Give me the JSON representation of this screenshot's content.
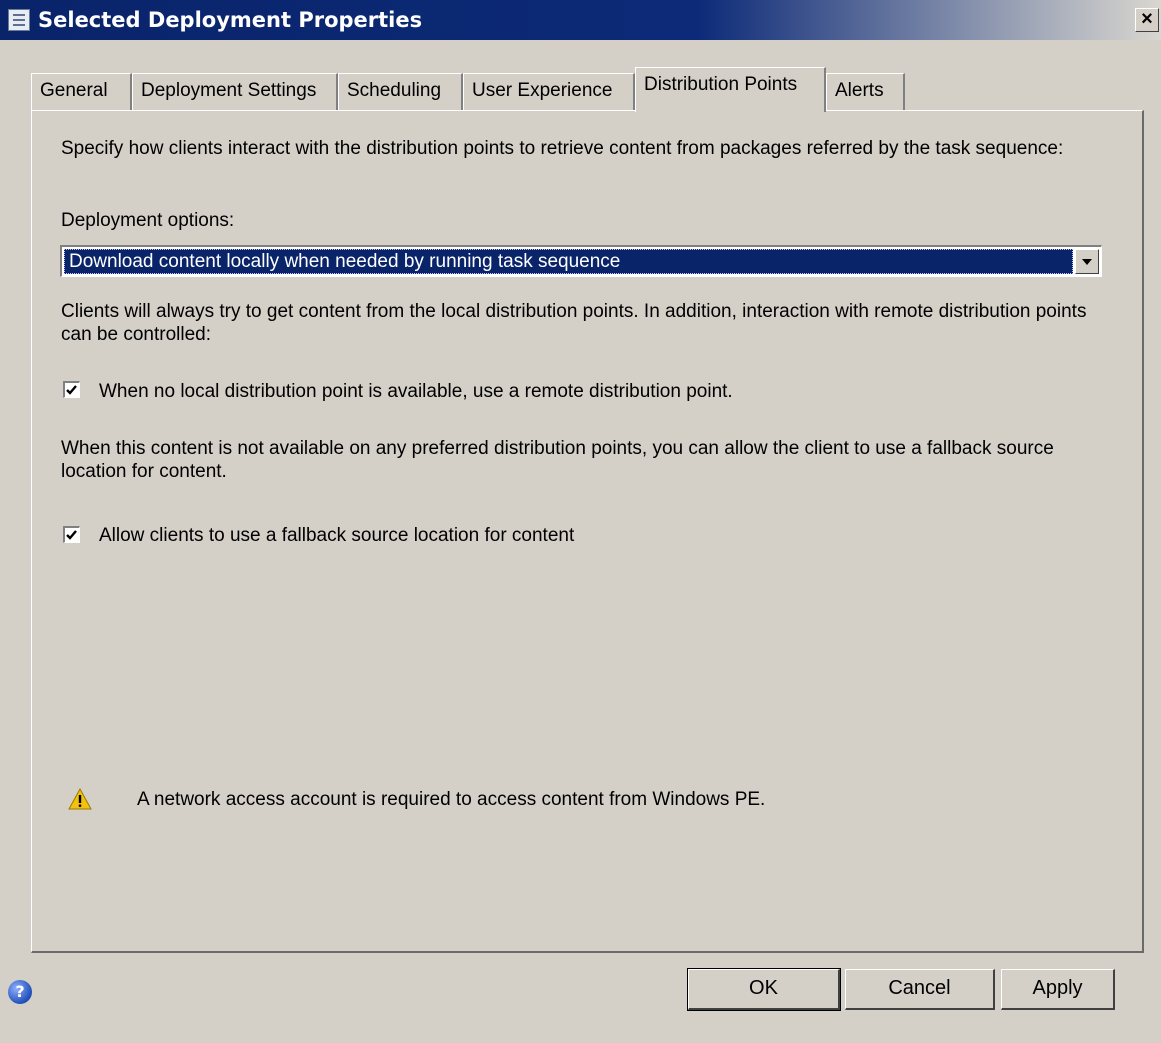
{
  "window": {
    "title": "Selected Deployment Properties",
    "close_label": "×"
  },
  "tabs": [
    {
      "label": "General",
      "active": false
    },
    {
      "label": "Deployment Settings",
      "active": false
    },
    {
      "label": "Scheduling",
      "active": false
    },
    {
      "label": "User Experience",
      "active": false
    },
    {
      "label": "Distribution Points",
      "active": true
    },
    {
      "label": "Alerts",
      "active": false
    }
  ],
  "panel": {
    "intro": "Specify how clients interact with the distribution points to retrieve content from packages referred by the task sequence:",
    "deployment_options_label": "Deployment options:",
    "deployment_option_value": "Download content locally when needed by running task sequence",
    "clients_info": "Clients will always try to get content from the local distribution points. In addition, interaction with remote distribution points can be controlled:",
    "remote_dp_checkbox": {
      "label": "When no local distribution point is available, use a remote distribution point.",
      "checked": true
    },
    "fallback_info": "When this content is not available on any preferred distribution points, you can allow the client to use a fallback source location for content.",
    "fallback_checkbox": {
      "label": "Allow clients to use a fallback source location for content",
      "checked": true
    },
    "warning": "A network access account is required to access content from Windows PE."
  },
  "buttons": {
    "help": "?",
    "ok": "OK",
    "cancel": "Cancel",
    "apply": "Apply"
  },
  "colors": {
    "titlebar": "#0a246a",
    "face": "#d4d0c8",
    "selection": "#0a246a",
    "warning": "#f3c20f"
  }
}
